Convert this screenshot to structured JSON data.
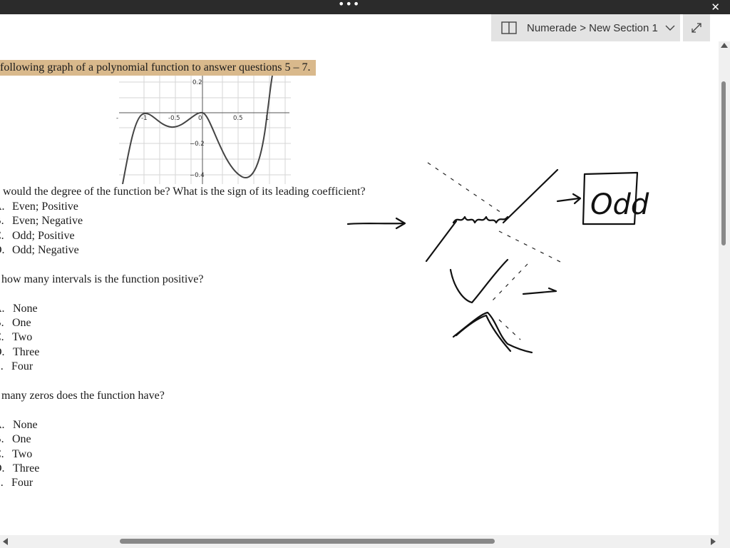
{
  "window": {
    "menu_glyph": "•••",
    "close_glyph": "✕"
  },
  "header": {
    "breadcrumb": "Numerade > New Section 1"
  },
  "document": {
    "heading": "following graph of a polynomial function to answer questions 5 – 7.",
    "graph": {
      "y_ticks": [
        "0.2",
        "−0.2",
        "−0.4"
      ],
      "x_ticks": [
        "-1",
        "-0.5",
        "0",
        "0.5",
        "1"
      ],
      "left_fragment": "-"
    },
    "questions": [
      {
        "prompt": "would the degree of the function be?  What is the sign of its leading coefficient?",
        "options": [
          {
            "letter": "A.",
            "text": "Even; Positive"
          },
          {
            "letter": "B.",
            "text": "Even; Negative"
          },
          {
            "letter": "C.",
            "text": "Odd; Positive"
          },
          {
            "letter": "D.",
            "text": "Odd; Negative"
          }
        ]
      },
      {
        "prompt": "how many intervals is the function positive?",
        "options": [
          {
            "letter": "A.",
            "text": "None"
          },
          {
            "letter": "B.",
            "text": "One"
          },
          {
            "letter": "C.",
            "text": "Two"
          },
          {
            "letter": "D.",
            "text": "Three"
          },
          {
            "letter": "E.",
            "text": "Four"
          }
        ]
      },
      {
        "prompt": "many zeros does the function have?",
        "options": [
          {
            "letter": "A.",
            "text": "None"
          },
          {
            "letter": "B.",
            "text": "One"
          },
          {
            "letter": "C.",
            "text": "Two"
          },
          {
            "letter": "D.",
            "text": "Three"
          },
          {
            "letter": "E.",
            "text": "Four"
          }
        ]
      }
    ]
  },
  "annotation": {
    "boxed_word": "Odd"
  },
  "colors": {
    "highlight": "#d9b98c",
    "titlebar": "#2b2b2b",
    "pill": "#e3e3e3"
  }
}
